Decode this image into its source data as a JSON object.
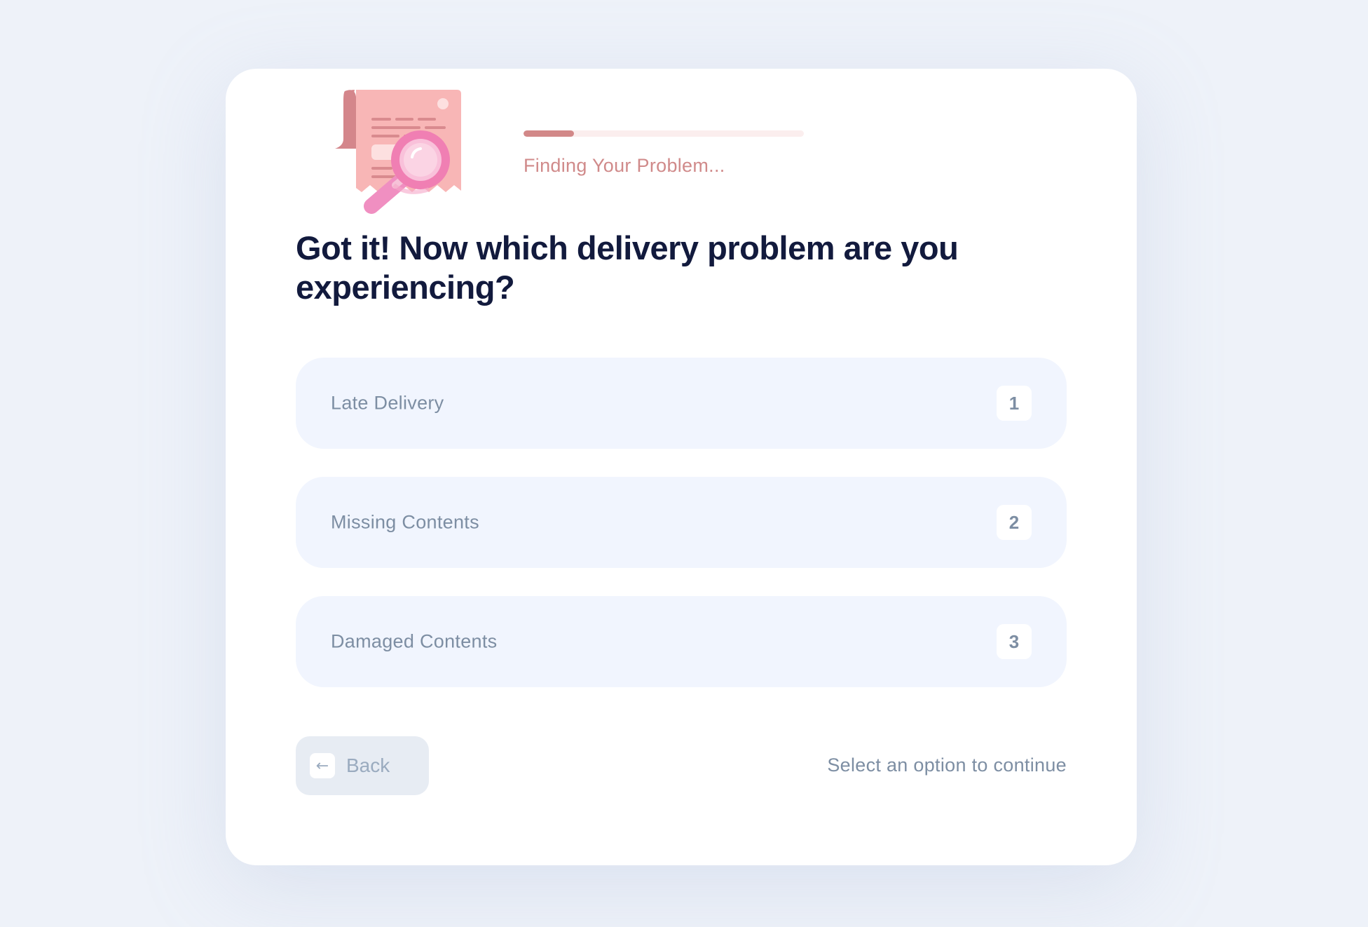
{
  "progress": {
    "label": "Finding Your Problem...",
    "fraction": 0.18,
    "fill_color": "#d28888",
    "track_color": "#fbeeee"
  },
  "illustration": {
    "icon": "receipt-magnifier-icon"
  },
  "question": {
    "title": "Got it! Now which delivery problem are you experiencing?"
  },
  "options": [
    {
      "label": "Late Delivery",
      "key": "1"
    },
    {
      "label": "Missing Contents",
      "key": "2"
    },
    {
      "label": "Damaged Contents",
      "key": "3"
    }
  ],
  "footer": {
    "back_label": "Back",
    "back_icon": "arrow-left-icon",
    "hint": "Select an option to continue"
  }
}
